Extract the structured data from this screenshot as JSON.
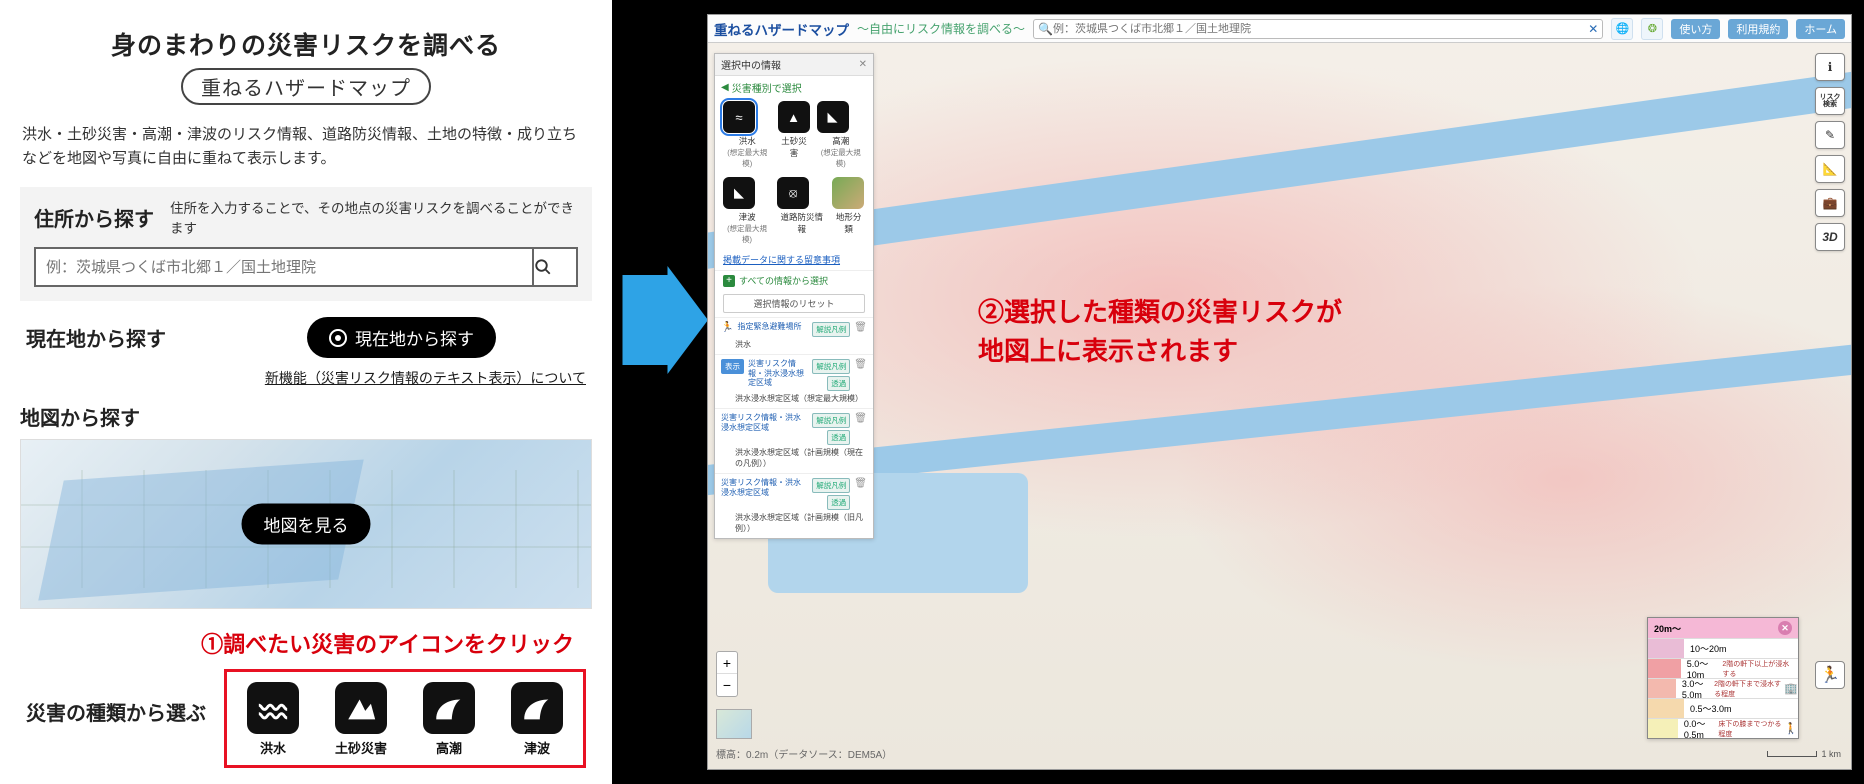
{
  "left": {
    "title1": "身のまわりの災害リスクを調べる",
    "title_chip": "重ねるハザードマップ",
    "description": "洪水・土砂災害・高潮・津波のリスク情報、道路防災情報、土地の特徴・成り立ちなどを地図や写真に自由に重ねて表示します。",
    "search_heading": "住所から探す",
    "search_sub": "住所を入力することで、その地点の災害リスクを調べることができます",
    "search_placeholder": "例：茨城県つくば市北郷１／国土地理院",
    "loc_heading": "現在地から探す",
    "loc_button": "現在地から探す",
    "new_func_link": "新機能（災害リスク情報のテキスト表示）について",
    "map_heading": "地図から探す",
    "view_map_button": "地図を見る",
    "callout1": "①調べたい災害のアイコンをクリック",
    "disaster_heading": "災害の種類から選ぶ",
    "disasters": [
      {
        "label": "洪水"
      },
      {
        "label": "土砂災害"
      },
      {
        "label": "高潮"
      },
      {
        "label": "津波"
      }
    ]
  },
  "right": {
    "app_title": "重ねるハザードマップ",
    "app_sub": "～自由にリスク情報を調べる～",
    "header_search_placeholder": "例：茨城県つくば市北郷１／国土地理院",
    "header_buttons": [
      "使い方",
      "利用規約",
      "ホーム"
    ],
    "sidepanel": {
      "title": "選択中の情報",
      "category_label": "災害種別で選択",
      "icons_row1": [
        {
          "label": "洪水",
          "sub": "(想定最大規模)",
          "selected": true
        },
        {
          "label": "土砂災害",
          "sub": ""
        },
        {
          "label": "高潮",
          "sub": "(想定最大規模)"
        }
      ],
      "icons_row2": [
        {
          "label": "津波",
          "sub": "(想定最大規模)"
        },
        {
          "label": "道路防災情報",
          "sub": ""
        },
        {
          "label": "地形分類",
          "sub": ""
        }
      ],
      "notice_link": "掲載データに関する留意事項",
      "all_info": "すべての情報から選択",
      "reset": "選択情報のリセット",
      "layers": [
        {
          "title": "指定緊急避難場所",
          "desc": "洪水"
        },
        {
          "title": "災害リスク情報・洪水浸水想定区域",
          "desc": "洪水浸水想定区域（想定最大規模）",
          "badge": "表示"
        },
        {
          "title": "災害リスク情報・洪水浸水想定区域",
          "desc": "洪水浸水想定区域（計画規模（現在の凡例））"
        },
        {
          "title": "災害リスク情報・洪水浸水想定区域",
          "desc": "洪水浸水想定区域（計画規模（旧凡例））"
        }
      ],
      "btn_legend": "解説凡例",
      "btn_trans": "透過"
    },
    "callout2_l1": "②選択した種類の災害リスクが",
    "callout2_l2": "地図上に表示されます",
    "legend": {
      "head": "20m～",
      "rows": [
        {
          "range": "10～20m",
          "color": "#e9bcd6",
          "note": ""
        },
        {
          "range": "5.0～10m",
          "color": "#f0a0a4",
          "note": "2階の軒下以上が浸水する"
        },
        {
          "range": "3.0～5.0m",
          "color": "#f3b9ae",
          "note": "2階の軒下まで浸水する程度"
        },
        {
          "range": "0.5～3.0m",
          "color": "#f5d9ad",
          "note": ""
        },
        {
          "range": "0.0～0.5m",
          "color": "#f5f0b8",
          "note": "床下の膝までつかる程度"
        }
      ]
    },
    "footer_elevation": "標高：0.2m（データソース：DEM5A）",
    "scale": "1 km",
    "tool_risk_l1": "リスク",
    "tool_risk_l2": "検索",
    "tool_3d": "3D"
  }
}
